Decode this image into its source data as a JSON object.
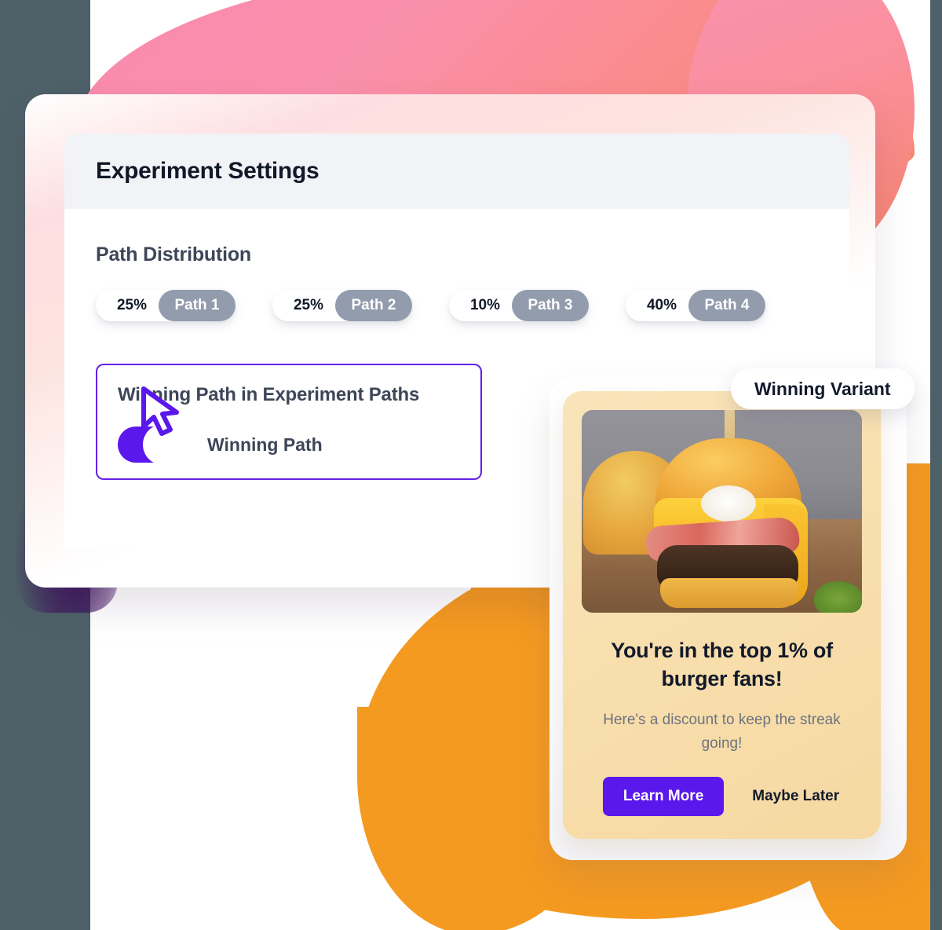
{
  "panel": {
    "header_title": "Experiment Settings",
    "section_title": "Path Distribution",
    "paths": [
      {
        "percent": "25%",
        "label": "Path 1"
      },
      {
        "percent": "25%",
        "label": "Path 2"
      },
      {
        "percent": "10%",
        "label": "Path 3"
      },
      {
        "percent": "40%",
        "label": "Path 4"
      }
    ],
    "winning_box": {
      "title": "Winning Path in Experiment Paths",
      "toggle_label": "Winning Path",
      "toggle_state": "on"
    }
  },
  "variant_card": {
    "badge": "Winning Variant",
    "title": "You're in the top 1% of burger fans!",
    "subtitle": "Here's a discount to keep the streak going!",
    "primary_button": "Learn More",
    "secondary_button": "Maybe Later"
  },
  "colors": {
    "purple": "#5a18ec",
    "pink_blob": "#f98ab0",
    "orange_blob": "#f59a20",
    "slate_strip": "#4e6168",
    "pill_gray": "#939cad",
    "card_cream": "#f8dfae"
  }
}
